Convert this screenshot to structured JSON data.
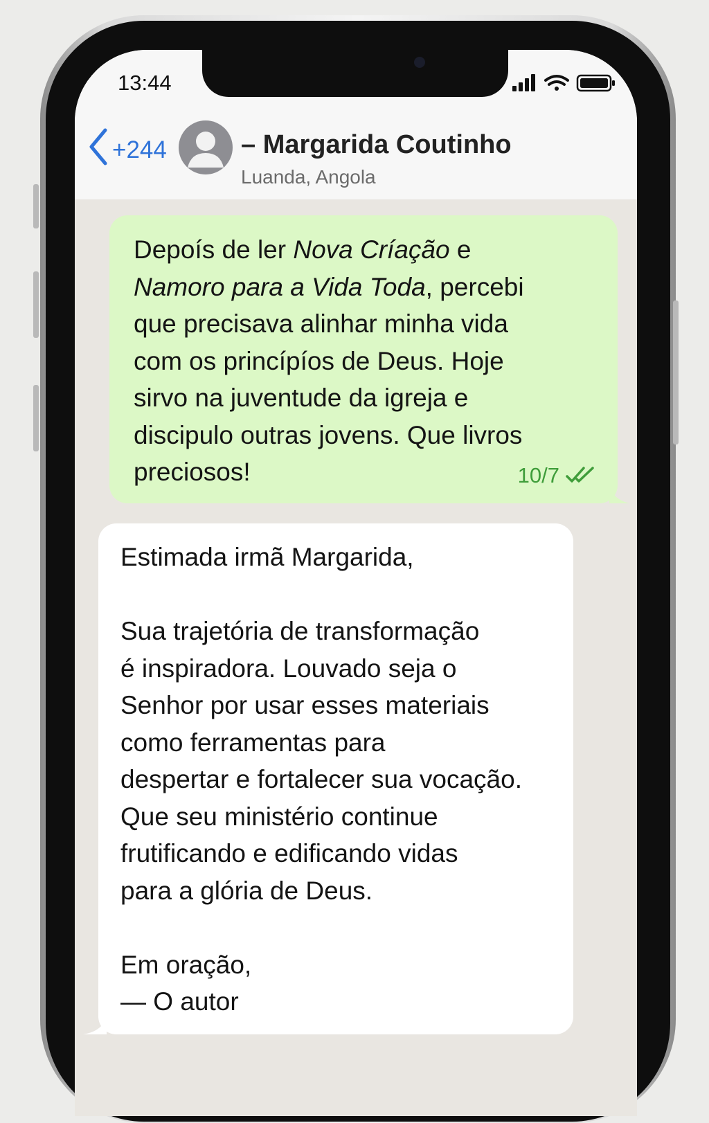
{
  "status_bar": {
    "time": "13:44",
    "icons": [
      "signal-icon",
      "wifi-icon",
      "battery-icon"
    ]
  },
  "header": {
    "back_icon": "chevron-left-icon",
    "back_label": "+244",
    "avatar_icon": "person-icon",
    "contact_name": "– Margarida Coutinho",
    "contact_location": "Luanda, Angola"
  },
  "messages": {
    "outgoing": {
      "lines": [
        [
          "Depoís de ler ",
          "Nova Críação",
          " e"
        ],
        [
          "",
          "Namoro para a Vida Toda",
          ", percebi"
        ],
        [
          "que precisava alinhar minha vida",
          "",
          ""
        ],
        [
          "com os princípíos de Deus. Hoje",
          "",
          ""
        ],
        [
          "sirvo na juventude da igreja e",
          "",
          ""
        ],
        [
          "discipulo outras jovens. Que livros",
          "",
          ""
        ],
        [
          "preciosos!",
          "",
          ""
        ]
      ],
      "date": "10/7",
      "status_icon": "double-check-icon"
    },
    "incoming": {
      "lines": [
        "Estimada irmã Margarida,",
        "",
        "Sua trajetória de transformação",
        "é inspiradora. Louvado seja o",
        "Senhor por usar esses materiais",
        "como ferramentas para",
        "despertar e fortalecer sua vocação.",
        "Que seu ministério continue",
        "frutificando e edificando vidas",
        "para a glória de Deus.",
        "",
        "Em oração,",
        "— O autor"
      ]
    }
  },
  "colors": {
    "outgoing_bubble": "#dcf8c6",
    "incoming_bubble": "#ffffff",
    "chat_background": "#e9e6e1",
    "accent_blue": "#2f73d9",
    "read_green": "#3f9d3a"
  }
}
